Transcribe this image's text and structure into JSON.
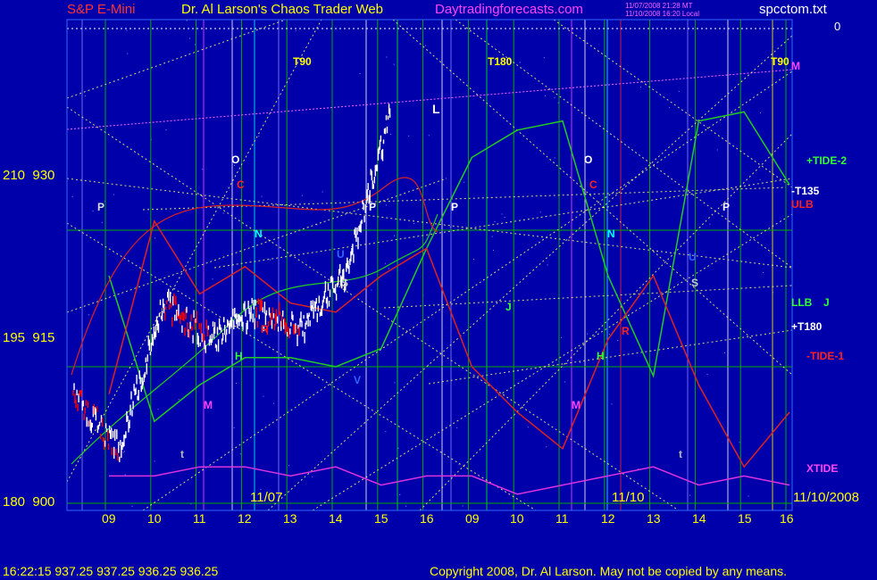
{
  "header": {
    "symbol": "S&P E-Mini",
    "site_title": "Dr. Al Larson's Chaos Trader Web",
    "site_url": "Daytradingforecasts.com",
    "stamp1": "11/07/2008 21:28 MT",
    "stamp2": "11/10/2008 16:20 Local",
    "file": "spcctom.txt",
    "corner_value": "0"
  },
  "footer": {
    "quote": "16:22:15  937.25 937.25 936.25 936.25",
    "copyright": "Copyright 2008, Dr. Al Larson. May not be copied by any means."
  },
  "y_axis_labels": [
    {
      "left": "210",
      "right": "930"
    },
    {
      "left": "195",
      "right": "915"
    },
    {
      "left": "180",
      "right": "900"
    }
  ],
  "x_axis_labels": [
    "09",
    "10",
    "11",
    "12",
    "13",
    "14",
    "15",
    "16",
    "09",
    "10",
    "11",
    "12",
    "13",
    "14",
    "15",
    "16"
  ],
  "date_labels": [
    "11/07",
    "11/10",
    "11/10/2008"
  ],
  "chart_labels": {
    "t90_a": "T90",
    "t180": "T180",
    "t90_b": "T90",
    "m_top": "M",
    "tide2": "+TIDE-2",
    "t135": "-T135",
    "ulb": "ULB",
    "llb": "LLB",
    "j_right": "J",
    "t180_plus": "+T180",
    "tide1": "-TIDE-1",
    "xtide": "XTIDE",
    "p1": "P",
    "o1": "O",
    "c1": "C",
    "n1": "N",
    "r1": "R",
    "h1": "H",
    "m1": "M",
    "t1": "t",
    "v1": "V",
    "s1": "S",
    "u1": "U",
    "p2": "P",
    "l1": "L",
    "p3": "P",
    "o2": "O",
    "c2": "C",
    "n2": "N",
    "j2": "J",
    "r2": "R",
    "h2": "H",
    "m2": "M",
    "u2": "U",
    "s2": "S",
    "t2": "t",
    "p4": "P"
  },
  "colors": {
    "background": "#0000aa",
    "price_bars": "#ffffff",
    "down_bars": "#ff0000",
    "gridlines": "#00aa00",
    "gann": "#ffff66",
    "xtide": "#dd33dd",
    "tide2": "#22cc22",
    "tide1": "#dd2222"
  },
  "chart_data": {
    "type": "line",
    "title": "S&P E-Mini",
    "xlabel": "",
    "ylabel": "",
    "ylim": [
      900,
      950
    ],
    "x": [
      "09",
      "10",
      "11",
      "12",
      "13",
      "14",
      "15",
      "16",
      "09",
      "10",
      "11",
      "12",
      "13",
      "14",
      "15",
      "16"
    ],
    "series": [
      {
        "name": "price",
        "values": [
          912,
          906,
          922,
          918,
          921,
          919,
          925,
          943,
          null,
          null,
          null,
          null,
          null,
          null,
          null,
          null
        ]
      },
      {
        "name": "+TIDE-2",
        "values": [
          925,
          909,
          913,
          916,
          916,
          915,
          917,
          928,
          938,
          941,
          942,
          925,
          914,
          942,
          943,
          935
        ]
      },
      {
        "name": "-TIDE-1",
        "values": [
          912,
          931,
          923,
          926,
          922,
          921,
          925,
          928,
          915,
          910,
          906,
          918,
          925,
          913,
          904,
          910
        ]
      },
      {
        "name": "XTIDE",
        "values": [
          903,
          903,
          904,
          904,
          903,
          904,
          902,
          903,
          903,
          901,
          902,
          903,
          904,
          902,
          903,
          902
        ]
      }
    ]
  }
}
